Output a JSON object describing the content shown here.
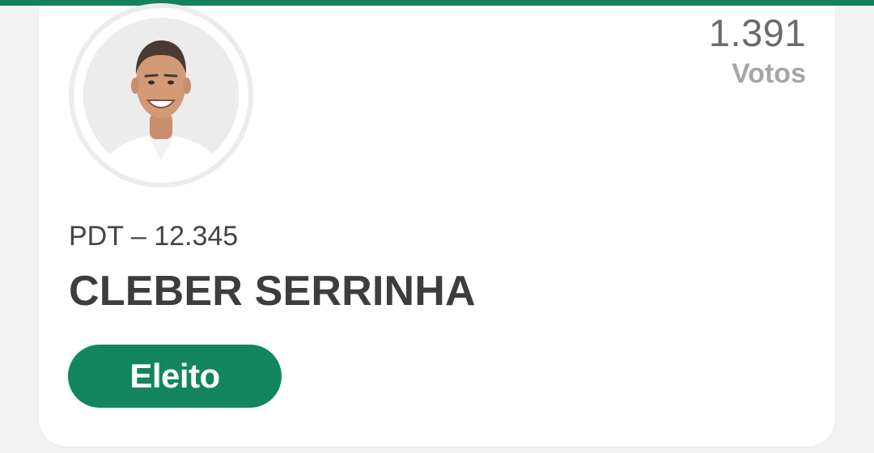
{
  "candidate": {
    "party_number": "PDT – 12.345",
    "name": "CLEBER SERRINHA",
    "status": "Eleito",
    "votes_count": "1.391",
    "votes_label": "Votos"
  },
  "colors": {
    "accent": "#13855f",
    "name_text": "#3d3d3d",
    "votes_text": "#6b6b6b",
    "votes_label_text": "#a6a6a6"
  },
  "icons": {
    "avatar": "candidate-photo"
  }
}
